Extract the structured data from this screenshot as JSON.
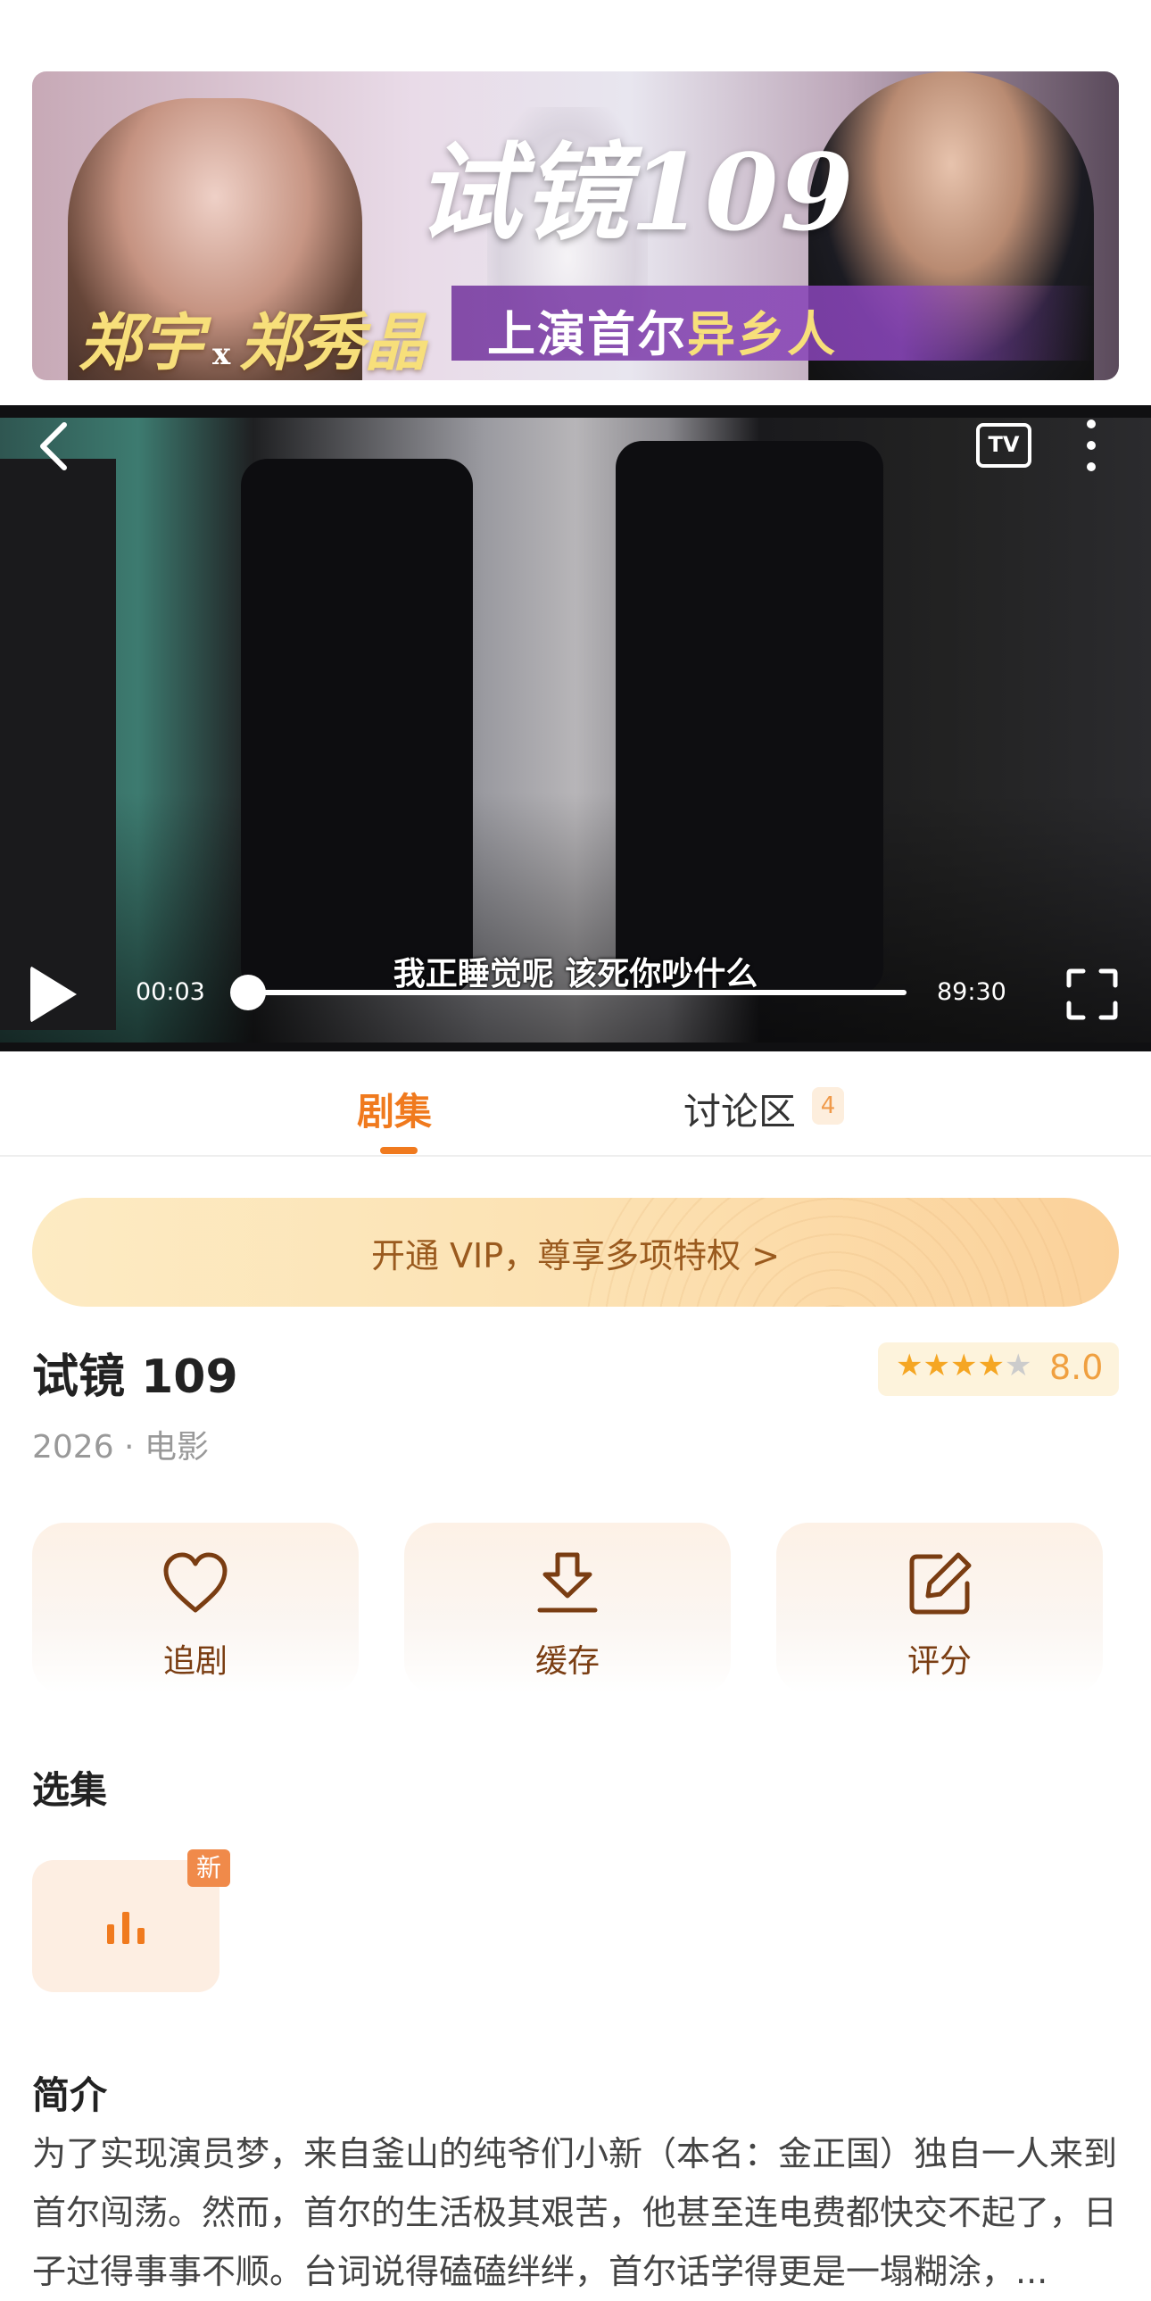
{
  "banner": {
    "title": "试镜109",
    "actor1": "郑宇",
    "x": "x",
    "actor2": "郑秀晶",
    "tag_prefix": "上演首尔",
    "tag_highlight": "异乡人"
  },
  "player": {
    "subtitle": "我正睡觉呢 该死你吵什么",
    "current_time": "00:03",
    "duration": "89:30",
    "progress": 0.001,
    "tv_label": "TV"
  },
  "tabs": {
    "episodes": "剧集",
    "discussion": "讨论区",
    "discussion_count": "4"
  },
  "vip": {
    "text": "开通 VIP，尊享多项特权 >"
  },
  "movie": {
    "title": "试镜 109",
    "rating_stars": 4,
    "rating_max": 5,
    "score": "8.0",
    "meta": "2026 · 电影"
  },
  "actions": {
    "follow": "追剧",
    "download": "缓存",
    "rate": "评分"
  },
  "episodes": {
    "title": "选集",
    "new_badge": "新"
  },
  "intro": {
    "title": "简介",
    "text": "为了实现演员梦，来自釜山的纯爷们小新（本名：金正国）独自一人来到首尔闯荡。然而，首尔的生活极其艰苦，他甚至连电费都快交不起了，日子过得事事不顺。台词说得磕磕绊绊，首尔话学得更是一塌糊涂，..."
  },
  "colors": {
    "accent": "#f07a1e",
    "brown": "#7a3d12"
  }
}
